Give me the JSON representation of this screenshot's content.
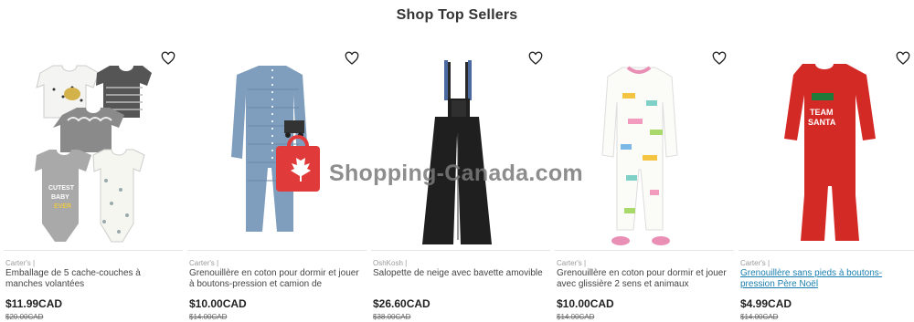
{
  "section_title": "Shop Top Sellers",
  "watermark": "Shopping-Canada.com",
  "products": [
    {
      "brand": "Carter's |",
      "name": "Emballage de 5 cache-couches à manches volantées",
      "price": "$11.99CAD",
      "was": "$20.00CAD",
      "icon": "heart-icon",
      "image": "bodysuit-5-pack"
    },
    {
      "brand": "Carter's |",
      "name": "Grenouillère en coton pour dormir et jouer à boutons-pression et camion de",
      "price": "$10.00CAD",
      "was": "$14.00CAD",
      "icon": "heart-icon",
      "image": "blue-sleeper"
    },
    {
      "brand": "OshKosh |",
      "name": "Salopette de neige avec bavette amovible",
      "price": "$26.60CAD",
      "was": "$38.00CAD",
      "icon": "heart-icon",
      "image": "snow-pants"
    },
    {
      "brand": "Carter's |",
      "name": "Grenouillère en coton pour dormir et jouer avec glissière 2 sens et animaux",
      "price": "$10.00CAD",
      "was": "$14.00CAD",
      "icon": "heart-icon",
      "image": "animal-sleeper"
    },
    {
      "brand": "Carter's |",
      "name": "Grenouillère sans pieds à boutons-pression Père Noël",
      "price": "$4.99CAD",
      "was": "$14.00CAD",
      "icon": "heart-icon",
      "image": "red-romper"
    }
  ],
  "colors": {
    "accent_link": "#1a7fb0",
    "watermark_red": "#e03a3a"
  }
}
